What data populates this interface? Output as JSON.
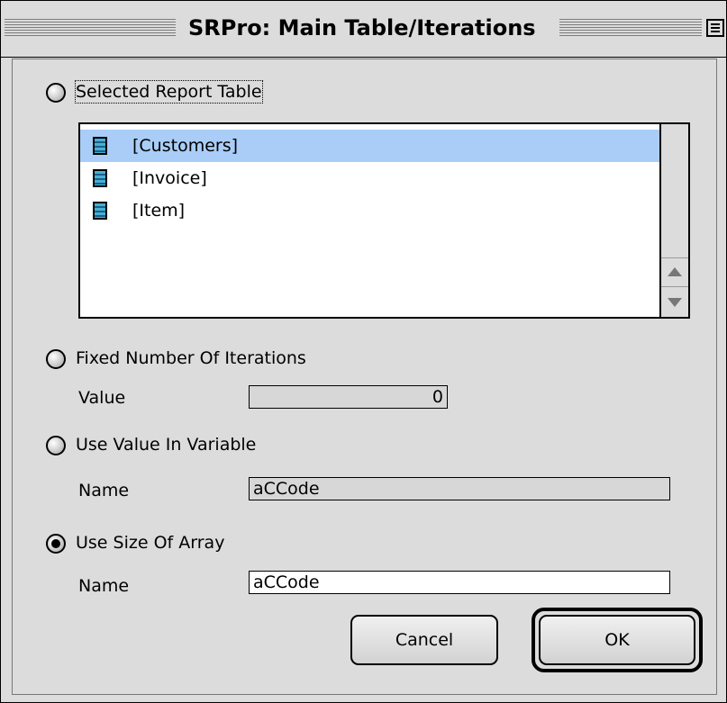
{
  "window": {
    "title": "SRPro: Main Table/Iterations"
  },
  "table_section": {
    "radio_label": "Selected Report Table",
    "items": [
      {
        "label": "[Customers]",
        "selected": true
      },
      {
        "label": "[Invoice]",
        "selected": false
      },
      {
        "label": "[Item]",
        "selected": false
      }
    ]
  },
  "fixed_iterations": {
    "radio_label": "Fixed Number Of Iterations",
    "field_label": "Value",
    "value": "0"
  },
  "variable_section": {
    "radio_label": "Use Value In Variable",
    "field_label": "Name",
    "value": "aCCode"
  },
  "array_section": {
    "radio_label": "Use Size Of Array",
    "field_label": "Name",
    "value": "aCCode",
    "selected": true
  },
  "buttons": {
    "cancel": "Cancel",
    "ok": "OK"
  }
}
